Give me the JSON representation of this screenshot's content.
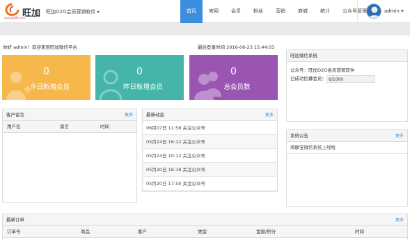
{
  "header": {
    "logo_text": "旺加",
    "logo_sub": "wangjia68.com",
    "app_title": "旺加O2O会员营销软件",
    "caret": "▾",
    "nav": [
      "首页",
      "官网",
      "会员",
      "粉丝",
      "营销",
      "商城",
      "统计",
      "公众号管理"
    ],
    "user": "admin",
    "user_caret": "▾"
  },
  "welcome": {
    "greeting": "你好 admin！欢迎来到旺加微信平台",
    "last_login": "最后登录时间 2016-06-23 15:44:03"
  },
  "stats": [
    {
      "value": "0",
      "label": "今日新增会员",
      "color": "#f6b84b",
      "icon": "add-user-icon"
    },
    {
      "value": "0",
      "label": "昨日新增会员",
      "color": "#45b5a9",
      "icon": "user-icon"
    },
    {
      "value": "0",
      "label": "总会员数",
      "color": "#9a55b2",
      "icon": "users-icon"
    }
  ],
  "messages": {
    "title": "客户留言",
    "more": "更多",
    "columns": [
      "用户名",
      "留言",
      "时间"
    ]
  },
  "activity": {
    "title": "最新动态",
    "more": "更多",
    "items": [
      "06月07日 11:58 关注公众号",
      "05月24日 16:12 关注公众号",
      "05月24日 10:12 关注公众号",
      "05月20日 18:18 关注公众号",
      "05月20日 17:50 关注公众号"
    ]
  },
  "system": {
    "title": "旺加微信系统",
    "account_line": "公众号：旺加O2O会员营销软件",
    "members_label": "已成功招募会员：",
    "members_value": "6/1000"
  },
  "notice": {
    "title": "系统公告",
    "more": "更多",
    "items": [
      "商联宝微信系统上线啦"
    ]
  },
  "orders": {
    "title": "最新订单",
    "more": "更多",
    "columns": [
      "订单号",
      "商品",
      "客户",
      "类型",
      "金额/积分",
      "时间"
    ]
  }
}
